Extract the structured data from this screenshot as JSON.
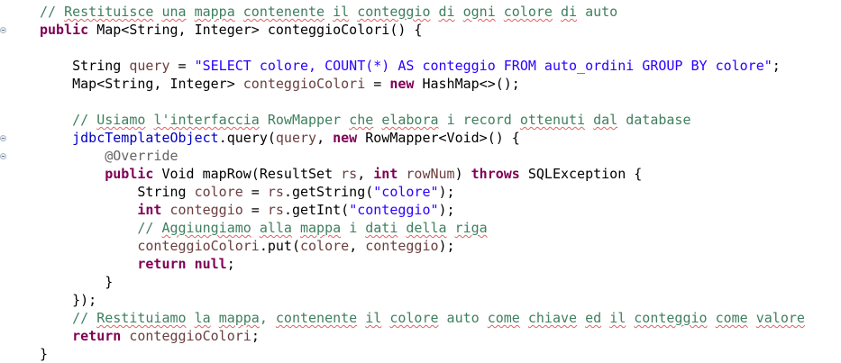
{
  "editor": {
    "lines": [
      {
        "indent": 0,
        "tokens": [
          {
            "t": "// ",
            "c": "cm"
          },
          {
            "t": "Restituisce",
            "c": "cm",
            "sq": true
          },
          {
            "t": " ",
            "c": "cm"
          },
          {
            "t": "una",
            "c": "cm",
            "sq": true
          },
          {
            "t": " ",
            "c": "cm"
          },
          {
            "t": "mappa",
            "c": "cm",
            "sq": true
          },
          {
            "t": " ",
            "c": "cm"
          },
          {
            "t": "contenente",
            "c": "cm",
            "sq": true
          },
          {
            "t": " ",
            "c": "cm"
          },
          {
            "t": "il",
            "c": "cm",
            "sq": true
          },
          {
            "t": " ",
            "c": "cm"
          },
          {
            "t": "conteggio",
            "c": "cm",
            "sq": true
          },
          {
            "t": " ",
            "c": "cm"
          },
          {
            "t": "di",
            "c": "cm",
            "sq": true
          },
          {
            "t": " ",
            "c": "cm"
          },
          {
            "t": "ogni",
            "c": "cm",
            "sq": true
          },
          {
            "t": " ",
            "c": "cm"
          },
          {
            "t": "colore",
            "c": "cm",
            "sq": true
          },
          {
            "t": " ",
            "c": "cm"
          },
          {
            "t": "di",
            "c": "cm",
            "sq": true
          },
          {
            "t": " ",
            "c": "cm"
          },
          {
            "t": "auto",
            "c": "cm"
          }
        ]
      },
      {
        "indent": 0,
        "tokens": [
          {
            "t": "public",
            "c": "kw"
          },
          {
            "t": " Map<String, Integer> conteggioColori() {"
          }
        ]
      },
      {
        "indent": 0,
        "tokens": []
      },
      {
        "indent": 1,
        "tokens": [
          {
            "t": "String "
          },
          {
            "t": "query",
            "c": "lv"
          },
          {
            "t": " = "
          },
          {
            "t": "\"SELECT colore, COUNT(*) AS conteggio FROM auto_ordini GROUP BY colore\"",
            "c": "str"
          },
          {
            "t": ";"
          }
        ]
      },
      {
        "indent": 1,
        "tokens": [
          {
            "t": "Map<String, Integer> "
          },
          {
            "t": "conteggioColori",
            "c": "lv"
          },
          {
            "t": " = "
          },
          {
            "t": "new",
            "c": "kw"
          },
          {
            "t": " HashMap<>();"
          }
        ]
      },
      {
        "indent": 0,
        "tokens": []
      },
      {
        "indent": 1,
        "tokens": [
          {
            "t": "// ",
            "c": "cm"
          },
          {
            "t": "Usiamo",
            "c": "cm",
            "sq": true
          },
          {
            "t": " ",
            "c": "cm"
          },
          {
            "t": "l'interfaccia",
            "c": "cm",
            "sq": true
          },
          {
            "t": " RowMapper ",
            "c": "cm"
          },
          {
            "t": "che",
            "c": "cm",
            "sq": true
          },
          {
            "t": " ",
            "c": "cm"
          },
          {
            "t": "elabora",
            "c": "cm",
            "sq": true
          },
          {
            "t": " ",
            "c": "cm"
          },
          {
            "t": "i",
            "c": "cm"
          },
          {
            "t": " record ",
            "c": "cm"
          },
          {
            "t": "ottenuti",
            "c": "cm",
            "sq": true
          },
          {
            "t": " ",
            "c": "cm"
          },
          {
            "t": "dal",
            "c": "cm",
            "sq": true
          },
          {
            "t": " database",
            "c": "cm"
          }
        ]
      },
      {
        "indent": 1,
        "tokens": [
          {
            "t": "jdbcTemplateObject",
            "c": "fld"
          },
          {
            "t": ".query("
          },
          {
            "t": "query",
            "c": "lv"
          },
          {
            "t": ", "
          },
          {
            "t": "new",
            "c": "kw"
          },
          {
            "t": " RowMapper<Void>() {"
          }
        ]
      },
      {
        "indent": 2,
        "tokens": [
          {
            "t": "@Override",
            "c": "ann"
          }
        ]
      },
      {
        "indent": 2,
        "tokens": [
          {
            "t": "public",
            "c": "kw"
          },
          {
            "t": " Void mapRow(ResultSet "
          },
          {
            "t": "rs",
            "c": "lv"
          },
          {
            "t": ", "
          },
          {
            "t": "int",
            "c": "kw"
          },
          {
            "t": " "
          },
          {
            "t": "rowNum",
            "c": "lv"
          },
          {
            "t": ") "
          },
          {
            "t": "throws",
            "c": "kw"
          },
          {
            "t": " SQLException {"
          }
        ]
      },
      {
        "indent": 3,
        "tokens": [
          {
            "t": "String "
          },
          {
            "t": "colore",
            "c": "lv"
          },
          {
            "t": " = "
          },
          {
            "t": "rs",
            "c": "lv"
          },
          {
            "t": ".getString("
          },
          {
            "t": "\"colore\"",
            "c": "str"
          },
          {
            "t": ");"
          }
        ]
      },
      {
        "indent": 3,
        "tokens": [
          {
            "t": "int",
            "c": "kw"
          },
          {
            "t": " "
          },
          {
            "t": "conteggio",
            "c": "lv"
          },
          {
            "t": " = "
          },
          {
            "t": "rs",
            "c": "lv"
          },
          {
            "t": ".getInt("
          },
          {
            "t": "\"conteggio\"",
            "c": "str"
          },
          {
            "t": ");"
          }
        ]
      },
      {
        "indent": 3,
        "tokens": [
          {
            "t": "// ",
            "c": "cm"
          },
          {
            "t": "Aggiungiamo",
            "c": "cm",
            "sq": true
          },
          {
            "t": " ",
            "c": "cm"
          },
          {
            "t": "alla",
            "c": "cm",
            "sq": true
          },
          {
            "t": " ",
            "c": "cm"
          },
          {
            "t": "mappa",
            "c": "cm",
            "sq": true
          },
          {
            "t": " ",
            "c": "cm"
          },
          {
            "t": "i",
            "c": "cm"
          },
          {
            "t": " ",
            "c": "cm"
          },
          {
            "t": "dati",
            "c": "cm",
            "sq": true
          },
          {
            "t": " ",
            "c": "cm"
          },
          {
            "t": "della",
            "c": "cm",
            "sq": true
          },
          {
            "t": " ",
            "c": "cm"
          },
          {
            "t": "riga",
            "c": "cm",
            "sq": true
          }
        ]
      },
      {
        "indent": 3,
        "tokens": [
          {
            "t": "conteggioColori",
            "c": "lv"
          },
          {
            "t": ".put("
          },
          {
            "t": "colore",
            "c": "lv"
          },
          {
            "t": ", "
          },
          {
            "t": "conteggio",
            "c": "lv"
          },
          {
            "t": ");"
          }
        ]
      },
      {
        "indent": 3,
        "tokens": [
          {
            "t": "return",
            "c": "kw"
          },
          {
            "t": " "
          },
          {
            "t": "null",
            "c": "kw"
          },
          {
            "t": ";"
          }
        ]
      },
      {
        "indent": 2,
        "tokens": [
          {
            "t": "}"
          }
        ]
      },
      {
        "indent": 1,
        "tokens": [
          {
            "t": "});"
          }
        ]
      },
      {
        "indent": 1,
        "tokens": [
          {
            "t": "// ",
            "c": "cm"
          },
          {
            "t": "Restituiamo",
            "c": "cm",
            "sq": true
          },
          {
            "t": " ",
            "c": "cm"
          },
          {
            "t": "la",
            "c": "cm",
            "sq": true
          },
          {
            "t": " ",
            "c": "cm"
          },
          {
            "t": "mappa",
            "c": "cm",
            "sq": true
          },
          {
            "t": ", ",
            "c": "cm"
          },
          {
            "t": "contenente",
            "c": "cm",
            "sq": true
          },
          {
            "t": " ",
            "c": "cm"
          },
          {
            "t": "il",
            "c": "cm",
            "sq": true
          },
          {
            "t": " ",
            "c": "cm"
          },
          {
            "t": "colore",
            "c": "cm",
            "sq": true
          },
          {
            "t": " auto ",
            "c": "cm"
          },
          {
            "t": "come",
            "c": "cm",
            "sq": true
          },
          {
            "t": " ",
            "c": "cm"
          },
          {
            "t": "chiave",
            "c": "cm",
            "sq": true
          },
          {
            "t": " ",
            "c": "cm"
          },
          {
            "t": "ed",
            "c": "cm",
            "sq": true
          },
          {
            "t": " ",
            "c": "cm"
          },
          {
            "t": "il",
            "c": "cm",
            "sq": true
          },
          {
            "t": " ",
            "c": "cm"
          },
          {
            "t": "conteggio",
            "c": "cm",
            "sq": true
          },
          {
            "t": " ",
            "c": "cm"
          },
          {
            "t": "come",
            "c": "cm",
            "sq": true
          },
          {
            "t": " ",
            "c": "cm"
          },
          {
            "t": "valore",
            "c": "cm",
            "sq": true
          }
        ]
      },
      {
        "indent": 1,
        "tokens": [
          {
            "t": "return",
            "c": "kw"
          },
          {
            "t": " "
          },
          {
            "t": "conteggioColori",
            "c": "lv"
          },
          {
            "t": ";"
          }
        ]
      },
      {
        "indent": 0,
        "tokens": [
          {
            "t": "}"
          }
        ]
      }
    ],
    "fold_markers": [
      {
        "line": 1,
        "icon": "fold-collapse-icon"
      },
      {
        "line": 7,
        "icon": "fold-collapse-icon"
      },
      {
        "line": 8,
        "icon": "fold-collapse-icon"
      }
    ]
  },
  "colors": {
    "keyword": "#7f0055",
    "string": "#2a00ff",
    "comment": "#3f7f5f",
    "field": "#0000c0",
    "annotation": "#646464",
    "local_variable": "#6a3e3e",
    "spellcheck_underline": "#e06060"
  }
}
